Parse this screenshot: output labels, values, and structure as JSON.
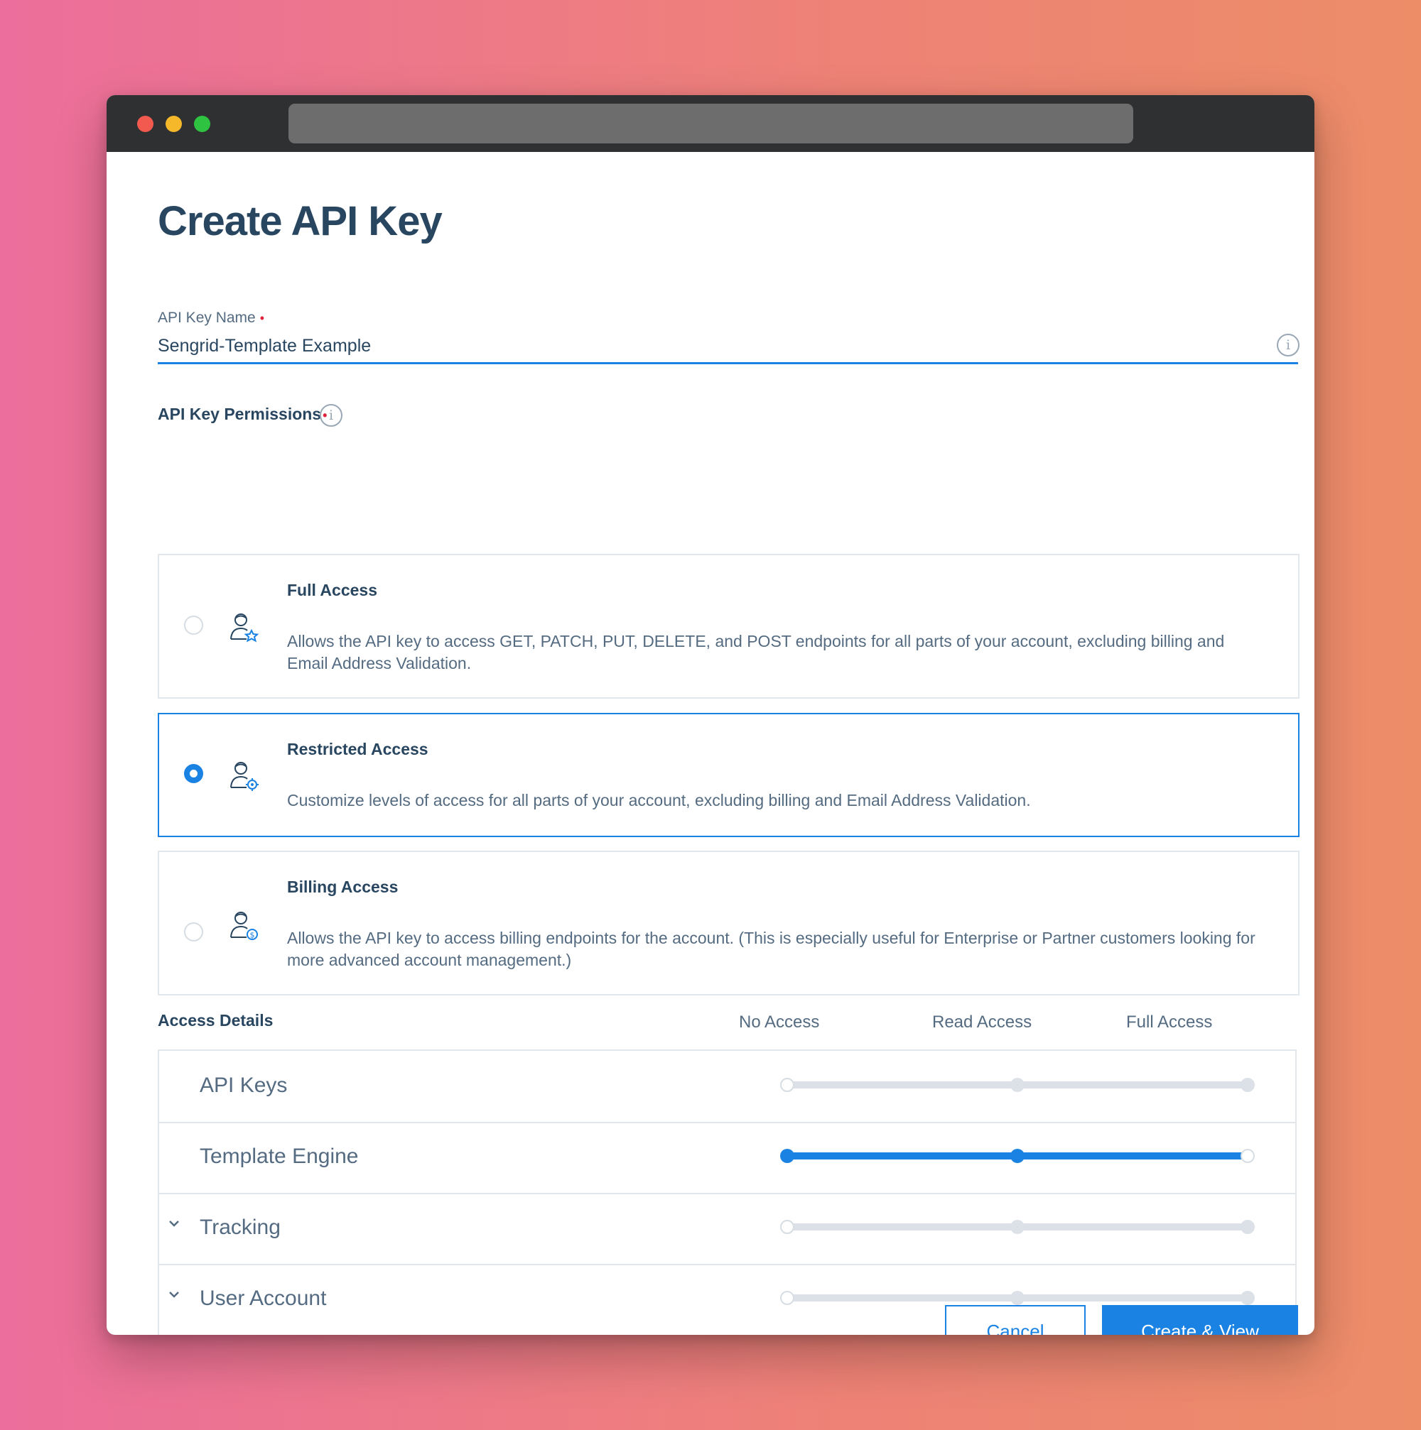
{
  "page": {
    "title": "Create API Key"
  },
  "api_key_name": {
    "label": "API Key Name",
    "required_mark": "•",
    "value": "Sengrid-Template Example",
    "info_icon": "info-icon"
  },
  "permissions": {
    "label": "API Key Permissions",
    "required_mark": "•",
    "info_icon": "info-icon",
    "selected": "Restricted Access",
    "options": [
      {
        "title": "Full Access",
        "description": "Allows the API key to access GET, PATCH, PUT, DELETE, and POST endpoints for all parts of your account, excluding billing and Email Address Validation.",
        "icon": "user-star-icon",
        "selected": false
      },
      {
        "title": "Restricted Access",
        "description": "Customize levels of access for all parts of your account, excluding billing and Email Address Validation.",
        "icon": "user-gear-icon",
        "selected": true
      },
      {
        "title": "Billing Access",
        "description": "Allows the API key to access billing endpoints for the account. (This is especially useful for Enterprise or Partner customers looking for more advanced account management.)",
        "icon": "user-dollar-icon",
        "selected": false
      }
    ]
  },
  "access_details": {
    "title": "Access Details",
    "columns": [
      "No Access",
      "Read Access",
      "Full Access"
    ],
    "rows": [
      {
        "label": "API Keys",
        "level": "No Access",
        "expandable": false
      },
      {
        "label": "Template Engine",
        "level": "Read Access",
        "expandable": false
      },
      {
        "label": "Tracking",
        "level": "No Access",
        "expandable": true
      },
      {
        "label": "User Account",
        "level": "No Access",
        "expandable": true
      }
    ]
  },
  "actions": {
    "cancel_label": "Cancel",
    "create_label": "Create & View"
  },
  "colors": {
    "accent": "#1a82e2",
    "heading": "#294661",
    "body_text": "#546b81",
    "required": "#e3233b"
  }
}
